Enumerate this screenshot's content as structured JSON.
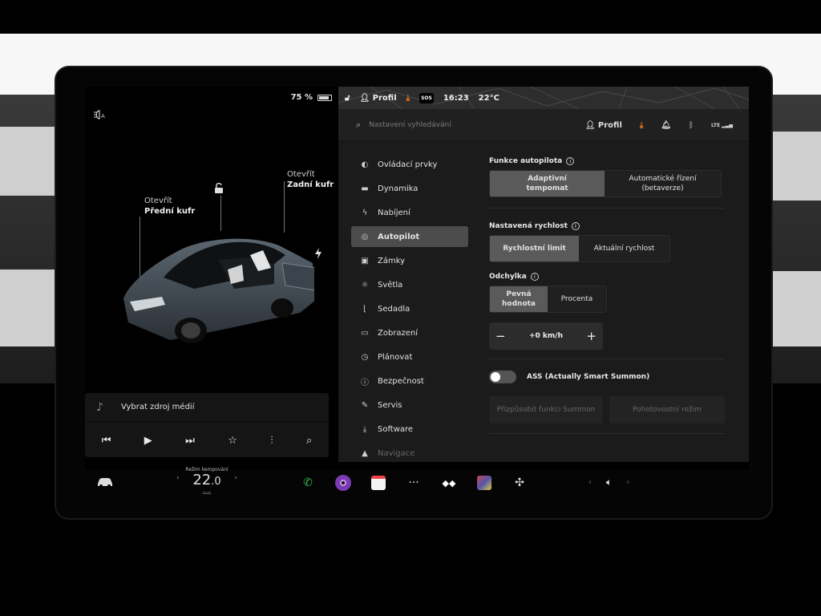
{
  "status": {
    "battery": "75 %",
    "profile": "Profil",
    "time": "16:23",
    "temperature": "22°C",
    "sos": "SOS"
  },
  "car_view": {
    "front_open": "Otevřít",
    "front_trunk": "Přední kufr",
    "rear_open": "Otevřít",
    "rear_trunk": "Zadní kufr"
  },
  "media": {
    "source": "Vybrat zdroj médií"
  },
  "search": {
    "placeholder": "Nastavení vyhledávání",
    "profile": "Profil",
    "lte": "LTE"
  },
  "nav": {
    "items": [
      {
        "label": "Ovládací prvky",
        "icon": "toggle-icon"
      },
      {
        "label": "Dynamika",
        "icon": "car-icon"
      },
      {
        "label": "Nabíjení",
        "icon": "bolt-icon"
      },
      {
        "label": "Autopilot",
        "icon": "steering-wheel-icon"
      },
      {
        "label": "Zámky",
        "icon": "lock-icon"
      },
      {
        "label": "Světla",
        "icon": "sun-icon"
      },
      {
        "label": "Sedadla",
        "icon": "seat-icon"
      },
      {
        "label": "Zobrazení",
        "icon": "display-icon"
      },
      {
        "label": "Plánovat",
        "icon": "alarm-icon"
      },
      {
        "label": "Bezpečnost",
        "icon": "alert-icon"
      },
      {
        "label": "Servis",
        "icon": "wrench-icon"
      },
      {
        "label": "Software",
        "icon": "download-icon"
      },
      {
        "label": "Navigace",
        "icon": "navigation-icon"
      }
    ],
    "active": "Autopilot"
  },
  "autopilot": {
    "features_title": "Funkce autopilota",
    "feature_opt1": "Adaptivní tempomat",
    "feature_opt2": "Automatické řízení (betaverze)",
    "speed_title": "Nastavená rychlost",
    "speed_opt1": "Rychlostní limit",
    "speed_opt2": "Aktuální rychlost",
    "offset_title": "Odchylka",
    "offset_opt1": "Pevná hodnota",
    "offset_opt2": "Procenta",
    "offset_value": "+0 km/h",
    "minus": "−",
    "plus": "+",
    "ass_label": "ASS (Actually Smart Summon)",
    "ass_enabled": false,
    "summon_customize": "Přizpůsobit funkci Summon",
    "standby": "Pohotovostní režim"
  },
  "dock": {
    "climate_mode": "Režim kempování",
    "temp_int": "22",
    "temp_dec": ".0",
    "apps": [
      "phone-icon",
      "camera-icon",
      "calendar-icon",
      "more-icon",
      "tidal-icon",
      "arcade-icon",
      "fan-icon"
    ]
  },
  "colors": {
    "accent_orange": "#ff7a1a",
    "active_bg": "#4c4c4c",
    "phone_green": "#3dbb4f",
    "camera_purple": "#7a3bb5"
  }
}
